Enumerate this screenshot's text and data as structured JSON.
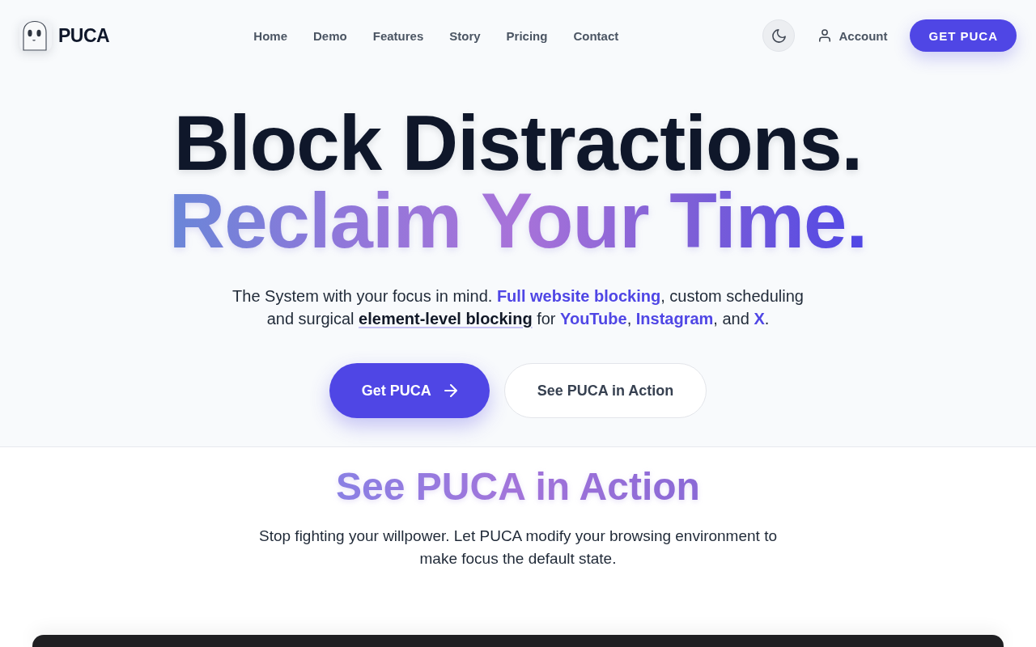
{
  "header": {
    "brand": "PUCA",
    "nav": [
      {
        "label": "Home"
      },
      {
        "label": "Demo"
      },
      {
        "label": "Features"
      },
      {
        "label": "Story"
      },
      {
        "label": "Pricing"
      },
      {
        "label": "Contact"
      }
    ],
    "account": "Account",
    "cta": "GET PUCA"
  },
  "hero": {
    "title": [
      {
        "kind": "plain",
        "text": "Block Distractions."
      },
      {
        "kind": "gradient",
        "text": "Reclaim Your Time."
      }
    ],
    "description": [
      {
        "kind": "text",
        "text": "The System with your focus in mind. "
      },
      {
        "kind": "link",
        "text": "Full website blocking"
      },
      {
        "kind": "text",
        "text": ", custom scheduling and surgical "
      },
      {
        "kind": "highlight",
        "text": "element-level blocking"
      },
      {
        "kind": "text",
        "text": " for "
      },
      {
        "kind": "link",
        "text": "YouTube"
      },
      {
        "kind": "text",
        "text": ", "
      },
      {
        "kind": "link",
        "text": "Instagram"
      },
      {
        "kind": "text",
        "text": ", and "
      },
      {
        "kind": "link",
        "text": "X"
      },
      {
        "kind": "text",
        "text": "."
      }
    ],
    "buttons": [
      {
        "kind": "primary",
        "label": "Get PUCA"
      },
      {
        "kind": "secondary",
        "label": "See PUCA in Action"
      }
    ]
  },
  "demo": {
    "title": "See PUCA in Action",
    "description": "Stop fighting your willpower. Let PUCA modify your browsing environment to make focus the default state."
  }
}
